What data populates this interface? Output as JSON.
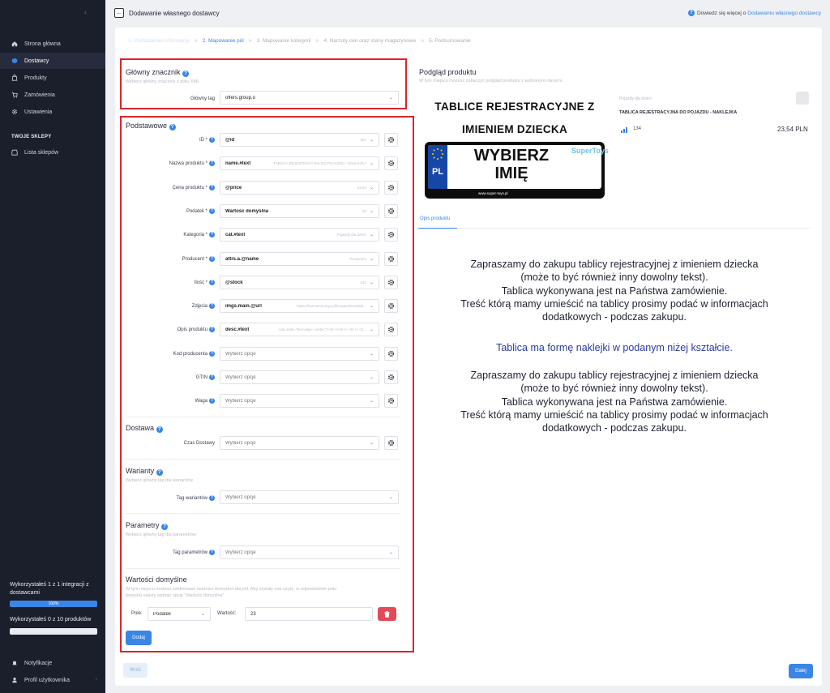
{
  "sidebar": {
    "collapse_icon": "chevron-left-icon",
    "nav": [
      {
        "label": "Strona główna",
        "icon": "home-icon"
      },
      {
        "label": "Dostawcy",
        "icon": "box-icon"
      },
      {
        "label": "Produkty",
        "icon": "bag-icon"
      },
      {
        "label": "Zamówienia",
        "icon": "cart-icon"
      },
      {
        "label": "Ustawienia",
        "icon": "gear-icon"
      }
    ],
    "shops_section": "TWOJE SKLEPY",
    "shops_item": {
      "label": "Lista sklepów",
      "icon": "shop-icon"
    },
    "usage": {
      "integrations_text": "Wykorzystałeś 1 z 1 integracji z dostawcami",
      "integrations_bar_label": "100%",
      "integrations_fraction": 1.0,
      "products_text": "Wykorzystałeś 0 z 10 produktów",
      "products_fraction": 0.0
    },
    "bottom": [
      {
        "label": "Notyfikacje",
        "icon": "bell-icon"
      },
      {
        "label": "Profil użytkownika",
        "icon": "user-icon"
      }
    ]
  },
  "header": {
    "title": "Dodawanie własnego dostawcy",
    "help_text": "Dowiedz się więcej o",
    "help_link": "Dodawaniu własnego dostawcy"
  },
  "steps": [
    {
      "label": "1. Podstawowe informacje",
      "state": "done"
    },
    {
      "label": "2. Mapowanie pól",
      "state": "active"
    },
    {
      "label": "3. Mapowanie kategorii",
      "state": "todo"
    },
    {
      "label": "4. Narzuty cen oraz stany magazynowe",
      "state": "todo"
    },
    {
      "label": "5. Podsumowanie",
      "state": "todo"
    }
  ],
  "main_tag": {
    "title": "Główny znacznik",
    "subtitle": "Wybierz główny znacznik z pliku XML",
    "label": "Główny tag",
    "value": "offers.group.o"
  },
  "basic": {
    "title": "Podstawowe",
    "rows": [
      {
        "label": "ID *",
        "value": "@id",
        "hint": "867"
      },
      {
        "label": "Nazwa produktu *",
        "value": "name.#text",
        "hint": "TABLICA REJESTRACYJNA DO POJAZDU - NAKLEJKA"
      },
      {
        "label": "Cena produktu *",
        "value": "@price",
        "hint": "23.54"
      },
      {
        "label": "Podatek *",
        "value": "Wartość domyślna",
        "hint": "23"
      },
      {
        "label": "Kategoria *",
        "value": "cat.#text",
        "hint": "Pojazdy dla dzieci"
      },
      {
        "label": "Producent *",
        "value": "attrs.a.@name",
        "hint": "Producent"
      },
      {
        "label": "Ilość *",
        "value": "@stock",
        "hint": "134"
      },
      {
        "label": "Zdjęcia",
        "value": "imgs.main.@url",
        "hint": "https://hurtownia-toys.pl/images/2016/tab..."
      },
      {
        "label": "Opis produktu",
        "value": "desc.#text",
        "hint": "<div style=\"text-align: center;\"><br /><br /> <br /> <b..."
      },
      {
        "label": "Kod producenta",
        "value": "Wybierz opcje",
        "hint": ""
      },
      {
        "label": "GTIN",
        "value": "Wybierz opcje",
        "hint": ""
      },
      {
        "label": "Waga",
        "value": "Wybierz opcje",
        "hint": ""
      }
    ]
  },
  "delivery": {
    "title": "Dostawa",
    "label": "Czas Dostawy",
    "value": "Wybierz opcje"
  },
  "variants": {
    "title": "Warianty",
    "subtitle": "Wybierz główny tag dla wariantów",
    "label": "Tag wariantów",
    "value": "Wybierz opcje"
  },
  "params": {
    "title": "Parametry",
    "subtitle": "Wybierz główny tag dla parametrów",
    "label": "Tag parametrów",
    "value": "Wybierz opcje"
  },
  "defaults": {
    "title": "Wartości domyślne",
    "subtitle_1": "W tym miejscu możesz zdefiniować wartości domyślne dla pól. Aby zostały one użyte, w odpowiednim polu",
    "subtitle_2": "powyżej należy wybrać opcję \"Wartość domyślna\".",
    "field_label": "Pole:",
    "field_value": "Podatek",
    "value_label": "Wartość:",
    "value": "23",
    "add_label": "Dodaj"
  },
  "footer": {
    "back_label": "Wróć",
    "next_label": "Dalej"
  },
  "preview": {
    "title": "Podgląd produktu",
    "subtitle": "W tym miejscu możesz zobaczyć podgląd produktu z wybranymi danymi.",
    "image_heading_1": "TABLICE REJESTRACYJNE Z",
    "image_heading_2": "IMIENIEM DZIECKA",
    "plate_country": "PL",
    "plate_text_1": "WYBIERZ",
    "plate_text_2": "IMIĘ",
    "plate_url": "www.super-toys.pl",
    "plate_logo": "SuperToys",
    "category": "Pojazdy dla dzieci",
    "name": "TABLICA REJESTRACYJNA DO POJAZDU - NAKLEJKA",
    "stock": "134",
    "price": "23,54 PLN",
    "tab": "Opis produktu",
    "desc_block": [
      "Zapraszamy do zakupu tablicy rejestracyjnej z imieniem dziecka",
      "(może to być również inny dowolny tekst).",
      "Tablica wykonywana jest na Państwa zamówienie.",
      "Treść którą mamy umieścić na tablicy prosimy podać w informacjach",
      "dodatkowych - podczas zakupu."
    ],
    "desc_highlight": "Tablica ma formę naklejki w podanym niżej kształcie."
  },
  "colors": {
    "accent": "#3a86e6",
    "sidebar_bg": "#1b1f2c",
    "highlight_box": "#d9262c",
    "delete": "#e24a57"
  }
}
